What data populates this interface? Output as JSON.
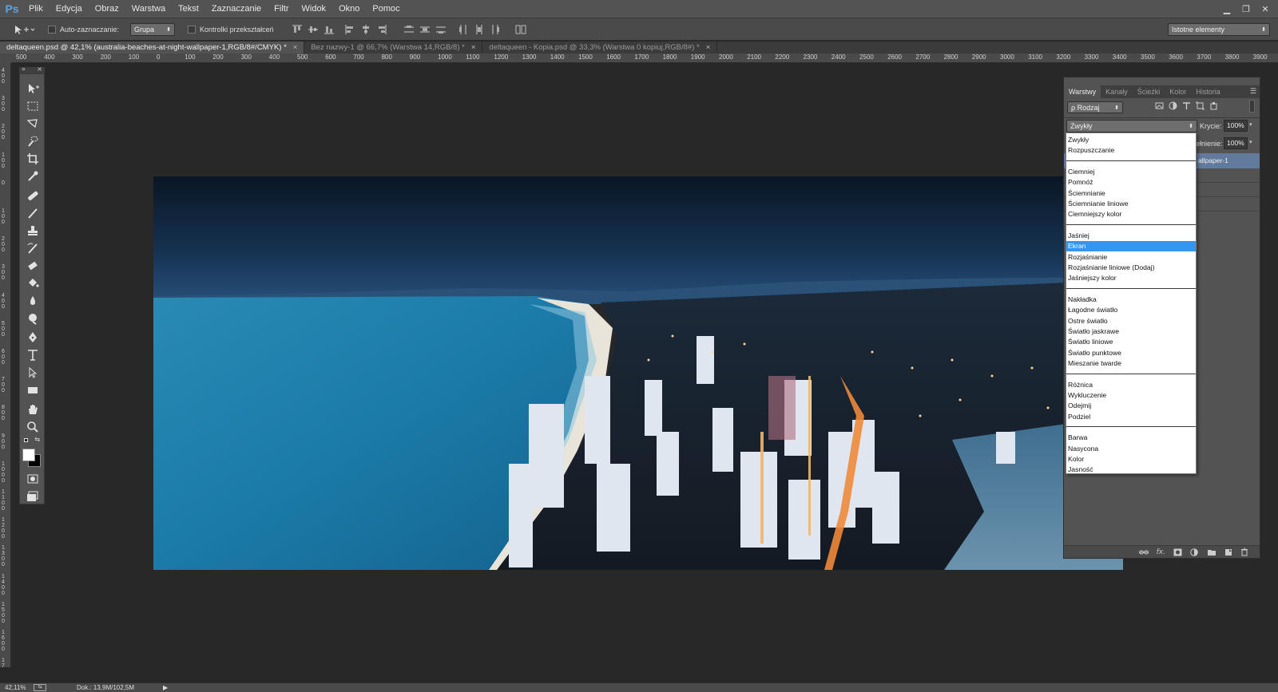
{
  "app": {
    "logo": "Ps"
  },
  "menubar": {
    "items": [
      "Plik",
      "Edycja",
      "Obraz",
      "Warstwa",
      "Tekst",
      "Zaznaczanie",
      "Filtr",
      "Widok",
      "Okno",
      "Pomoc"
    ]
  },
  "window_controls": {
    "minimize": "▁",
    "restore": "❐",
    "close": "✕"
  },
  "options_bar": {
    "auto_select_label": "Auto-zaznaczanie:",
    "auto_select_value": "Grupa",
    "transform_controls_label": "Kontrolki przekształceń",
    "workspace_value": "Istotne elementy"
  },
  "tabs": [
    {
      "label": "deltaqueen.psd @ 42,1% (australia-beaches-at-night-wallpaper-1,RGB/8#/CMYK) *",
      "close": "×"
    },
    {
      "label": "Bez nazwy-1 @ 66,7% (Warstwa 14,RGB/8) *",
      "close": "×"
    },
    {
      "label": "deltaqueen - Kopia.psd @ 33,3% (Warstwa 0 kopiuj,RGB/8#) *",
      "close": "×"
    }
  ],
  "ruler": {
    "h_labels": [
      "500",
      "400",
      "300",
      "200",
      "100",
      "0",
      "100",
      "200",
      "300",
      "400",
      "500",
      "600",
      "700",
      "800",
      "900",
      "1000",
      "1100",
      "1200",
      "1300",
      "1400",
      "1500",
      "1600",
      "1700",
      "1800",
      "1900",
      "2000",
      "2100",
      "2200",
      "2300",
      "2400",
      "2500",
      "2600",
      "2700",
      "2800",
      "2900",
      "3000",
      "3100",
      "3200",
      "3300",
      "3400",
      "3500",
      "3600",
      "3700",
      "3800",
      "3900"
    ],
    "v_labels": [
      "4 0 0",
      "3 0 0",
      "2 0 0",
      "1 0 0",
      "0",
      "1 0 0",
      "2 0 0",
      "3 0 0",
      "4 0 0",
      "5 0 0",
      "6 0 0",
      "7 0 0",
      "8 0 0",
      "9 0 0",
      "1 0 0 0",
      "1 1 0 0",
      "1 2 0 0",
      "1 3 0 0",
      "1 4 0 0",
      "1 5 0 0",
      "1 6 0 0",
      "1 7 0 0"
    ]
  },
  "layers_panel": {
    "tabs": [
      "Warstwy",
      "Kanały",
      "Ścieżki",
      "Kolor",
      "Historia"
    ],
    "kind_filter": "ρ Rodzaj",
    "blend_mode": "Zwykły",
    "opacity_label": "Krycie:",
    "opacity_value": "100%",
    "fill_label": "ełnienie:",
    "fill_value": "100%",
    "layer_name": "allpaper-1"
  },
  "blend_modes": [
    {
      "label": "Zwykły",
      "selected": false
    },
    {
      "label": "Rozpuszczanie",
      "selected": false
    },
    {
      "label": "Ciemniej",
      "selected": false
    },
    {
      "label": "Pomnóż",
      "selected": false
    },
    {
      "label": "Ściemnianie",
      "selected": false
    },
    {
      "label": "Ściemnianie liniowe",
      "selected": false
    },
    {
      "label": "Ciemniejszy kolor",
      "selected": false
    },
    {
      "label": "Jaśniej",
      "selected": false
    },
    {
      "label": "Ekran",
      "selected": true
    },
    {
      "label": "Rozjaśnianie",
      "selected": false
    },
    {
      "label": "Rozjaśnianie liniowe (Dodaj)",
      "selected": false
    },
    {
      "label": "Jaśniejszy kolor",
      "selected": false
    },
    {
      "label": "Nakładka",
      "selected": false
    },
    {
      "label": "Łagodne światło",
      "selected": false
    },
    {
      "label": "Ostre światło",
      "selected": false
    },
    {
      "label": "Światło jaskrawe",
      "selected": false
    },
    {
      "label": "Światło liniowe",
      "selected": false
    },
    {
      "label": "Światło punktowe",
      "selected": false
    },
    {
      "label": "Mieszanie twarde",
      "selected": false
    },
    {
      "label": "Różnica",
      "selected": false
    },
    {
      "label": "Wykluczenie",
      "selected": false
    },
    {
      "label": "Odejmij",
      "selected": false
    },
    {
      "label": "Podziel",
      "selected": false
    },
    {
      "label": "Barwa",
      "selected": false
    },
    {
      "label": "Nasycona",
      "selected": false
    },
    {
      "label": "Kolor",
      "selected": false
    },
    {
      "label": "Jasność",
      "selected": false
    }
  ],
  "status_bar": {
    "zoom": "42,11%",
    "doc": "Dok.: 13,9M/102,5M"
  },
  "colors": {
    "selection": "#3396f0",
    "panel": "#535353",
    "canvas_bg": "#282828"
  }
}
